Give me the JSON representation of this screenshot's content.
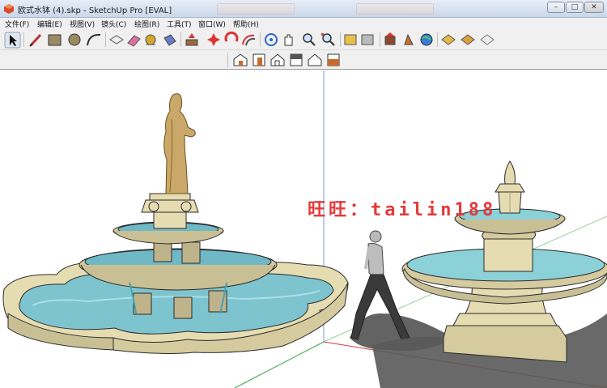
{
  "window": {
    "title": "欧式水钵 (4).skp - SketchUp Pro [EVAL]",
    "icon": "sketchup-icon",
    "controls": [
      "minimize-button",
      "maximize-button",
      "close-button"
    ]
  },
  "menubar": {
    "items": [
      {
        "label": "文件(F)"
      },
      {
        "label": "编辑(E)"
      },
      {
        "label": "视图(V)"
      },
      {
        "label": "镜头(C)"
      },
      {
        "label": "绘图(R)"
      },
      {
        "label": "工具(T)"
      },
      {
        "label": "窗口(W)"
      },
      {
        "label": "帮助(H)"
      }
    ]
  },
  "toolbar": {
    "tools": [
      "select-icon",
      "pencil-icon",
      "rectangle-icon",
      "circle-icon",
      "arc-icon",
      "make-component-icon",
      "eraser-icon",
      "tape-measure-icon",
      "paint-bucket-icon",
      "push-pull-icon",
      "move-icon",
      "rotate-icon",
      "offset-icon",
      "orbit-icon",
      "pan-icon",
      "zoom-icon",
      "zoom-extents-icon",
      "3d-warehouse-icon",
      "share-model-icon",
      "get-models-icon",
      "components-icon",
      "google-earth-icon",
      "photo-textures-icon",
      "extension-warehouse-icon",
      "layout-icon"
    ],
    "views": [
      "iso-view-icon",
      "front-view-icon",
      "top-view-icon",
      "right-view-icon",
      "back-view-icon",
      "left-view-icon"
    ]
  },
  "viewport": {
    "watermark": "旺旺：tailin188",
    "scene": "fountain-models",
    "colors": {
      "stone": "#e6dcb2",
      "stone_dark": "#9c8f63",
      "water": "#7ec4cf",
      "water_dark": "#3e8ea1",
      "statue": "#c9a869",
      "shadow": "#5b5b5b",
      "axis_green": "#3aa34a",
      "axis_red": "#d23a3a",
      "axis_blue": "#3b5fd1"
    }
  }
}
